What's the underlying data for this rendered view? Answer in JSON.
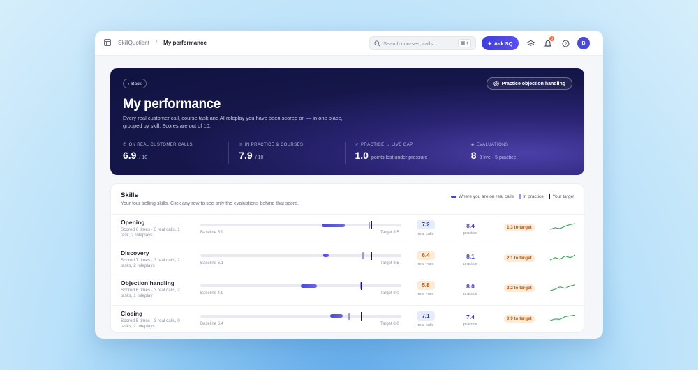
{
  "topbar": {
    "app_name": "SkillQuotient",
    "separator": "/",
    "page_name": "My performance",
    "search_placeholder": "Search courses, calls...",
    "search_shortcut": "⌘K",
    "ask_label": "Ask SQ",
    "notification_count": "3",
    "avatar_initial": "B"
  },
  "hero": {
    "back_label": "Back",
    "practice_label": "Practice objection handling",
    "title": "My performance",
    "description": "Every real customer call, course task and AI roleplay you have been scored on — in one place, grouped by skill. Scores are out of 10.",
    "stats": [
      {
        "label": "ON REAL CUSTOMER CALLS",
        "value": "6.9",
        "sub": "/ 10",
        "icon": "phone-icon"
      },
      {
        "label": "IN PRACTICE & COURSES",
        "value": "7.9",
        "sub": "/ 10",
        "icon": "target-icon"
      },
      {
        "label": "PRACTICE → LIVE GAP",
        "value": "1.0",
        "sub": "points lost under pressure",
        "icon": "trend-icon"
      },
      {
        "label": "EVALUATIONS",
        "value": "8",
        "sub": "3 live · 5 practice",
        "icon": "layers-icon"
      }
    ]
  },
  "skills": {
    "title": "Skills",
    "subtitle": "Your four selling skills. Click any row to see only the evaluations behind that score.",
    "legend": {
      "real": "Where you are on real calls",
      "practice": "In practice",
      "target": "Your target"
    },
    "rows": [
      {
        "name": "Opening",
        "meta": "Scored 6 times · 3 real calls, 1 task, 2 roleplays",
        "baseline": 5.9,
        "baseline_label": "Baseline 5.9",
        "target": 8.5,
        "target_label": "Target 8.5",
        "real": 7.2,
        "real_label": "7.2",
        "real_sub": "real calls",
        "practice": 8.4,
        "practice_label": "8.4",
        "practice_sub": "practice",
        "gap": "1.3 to target",
        "tone": "blue",
        "trend": [
          3,
          4,
          3.5,
          5,
          6,
          6.5
        ]
      },
      {
        "name": "Discovery",
        "meta": "Scored 7 times · 3 real calls, 2 tasks, 2 roleplays",
        "baseline": 6.1,
        "baseline_label": "Baseline 6.1",
        "target": 8.5,
        "target_label": "Target 8.5",
        "real": 6.4,
        "real_label": "6.4",
        "real_sub": "real calls",
        "practice": 8.1,
        "practice_label": "8.1",
        "practice_sub": "practice",
        "gap": "2.1 to target",
        "tone": "orange",
        "trend": [
          3,
          4.5,
          3.5,
          5.5,
          4.5,
          6
        ]
      },
      {
        "name": "Objection handling",
        "meta": "Scored 6 times · 3 real calls, 2 tasks, 1 roleplay",
        "baseline": 4.9,
        "baseline_label": "Baseline 4.9",
        "target": 8.0,
        "target_label": "Target 8.0",
        "real": 5.8,
        "real_label": "5.8",
        "real_sub": "real calls",
        "practice": 8.0,
        "practice_label": "8.0",
        "practice_sub": "practice",
        "gap": "2.2 to target",
        "tone": "orange",
        "trend": [
          2.5,
          3.5,
          5,
          4,
          5.5,
          6.2
        ]
      },
      {
        "name": "Closing",
        "meta": "Scored 5 times · 3 real calls, 0 tasks, 2 roleplays",
        "baseline": 6.4,
        "baseline_label": "Baseline 6.4",
        "target": 8.0,
        "target_label": "Target 8.0",
        "real": 7.1,
        "real_label": "7.1",
        "real_sub": "real calls",
        "practice": 7.4,
        "practice_label": "7.4",
        "practice_sub": "practice",
        "gap": "0.9 to target",
        "tone": "blue",
        "trend": [
          3,
          4,
          3.8,
          5.5,
          6,
          6.4
        ]
      }
    ]
  },
  "colors": {
    "accent": "#4543d6",
    "practice": "#9b96ef",
    "trend": "#3aa055",
    "warning": "#b85a14"
  }
}
